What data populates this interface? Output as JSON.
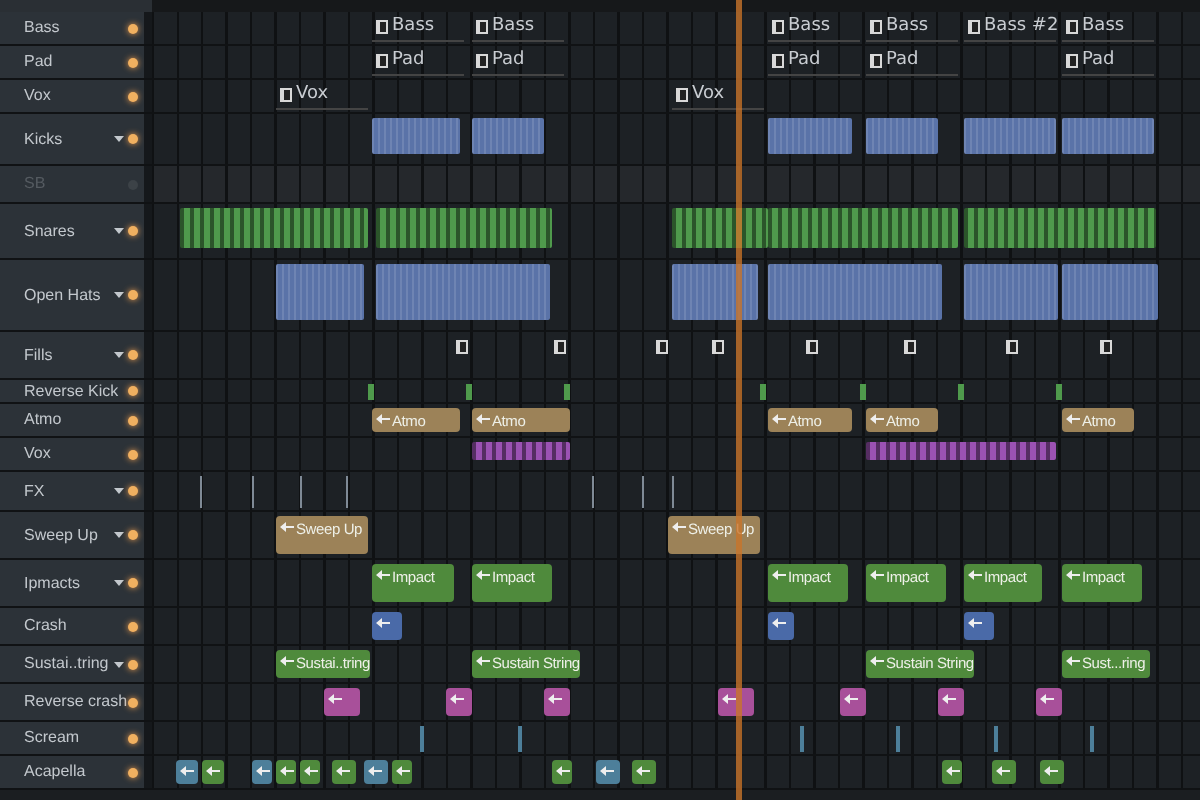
{
  "tracks": [
    {
      "name": "Bass",
      "dropdown": false,
      "muted": false,
      "clips": [
        {
          "kind": "pattern",
          "label": "Bass"
        },
        {
          "kind": "pattern",
          "label": "Bass"
        },
        {
          "kind": "pattern",
          "label": "Bass"
        },
        {
          "kind": "pattern",
          "label": "Bass"
        },
        {
          "kind": "pattern",
          "label": "Bass #2"
        },
        {
          "kind": "pattern",
          "label": "Bass"
        }
      ]
    },
    {
      "name": "Pad",
      "dropdown": false,
      "muted": false,
      "clips": [
        {
          "kind": "pattern",
          "label": "Pad"
        },
        {
          "kind": "pattern",
          "label": "Pad"
        },
        {
          "kind": "pattern",
          "label": "Pad"
        },
        {
          "kind": "pattern",
          "label": "Pad"
        },
        {
          "kind": "pattern",
          "label": "Pad"
        }
      ]
    },
    {
      "name": "Vox",
      "dropdown": false,
      "muted": false,
      "clips": [
        {
          "kind": "pattern",
          "label": "Vox"
        },
        {
          "kind": "pattern",
          "label": "Vox"
        }
      ]
    },
    {
      "name": "Kicks",
      "dropdown": true,
      "muted": false,
      "clips": [
        {
          "kind": "block",
          "color": "#5a73a8"
        },
        {
          "kind": "block",
          "color": "#5a73a8"
        },
        {
          "kind": "block",
          "color": "#5a73a8"
        },
        {
          "kind": "block",
          "color": "#5a73a8"
        },
        {
          "kind": "block",
          "color": "#5a73a8"
        },
        {
          "kind": "block",
          "color": "#5a73a8"
        }
      ]
    },
    {
      "name": "SB",
      "dropdown": false,
      "muted": true
    },
    {
      "name": "Snares",
      "dropdown": true,
      "muted": false,
      "clips": [
        {
          "kind": "stripes",
          "color": "#4f9a4c"
        },
        {
          "kind": "stripes",
          "color": "#4f9a4c"
        },
        {
          "kind": "stripes",
          "color": "#4f9a4c"
        },
        {
          "kind": "stripes",
          "color": "#4f9a4c"
        },
        {
          "kind": "stripes",
          "color": "#4f9a4c"
        }
      ]
    },
    {
      "name": "Open Hats",
      "dropdown": true,
      "muted": false,
      "clips": [
        {
          "kind": "block",
          "color": "#5a73a8"
        },
        {
          "kind": "block",
          "color": "#5a73a8"
        },
        {
          "kind": "block",
          "color": "#5a73a8"
        },
        {
          "kind": "block",
          "color": "#5a73a8"
        },
        {
          "kind": "block",
          "color": "#5a73a8"
        },
        {
          "kind": "block",
          "color": "#5a73a8"
        }
      ]
    },
    {
      "name": "Fills",
      "dropdown": true,
      "muted": false,
      "clips": [
        {
          "kind": "mini"
        },
        {
          "kind": "mini"
        },
        {
          "kind": "mini"
        },
        {
          "kind": "mini"
        },
        {
          "kind": "mini"
        },
        {
          "kind": "mini"
        },
        {
          "kind": "mini"
        },
        {
          "kind": "mini"
        }
      ]
    },
    {
      "name": "Reverse Kick",
      "dropdown": false,
      "muted": false,
      "clips": [
        {
          "kind": "mark",
          "color": "#4f9a4c"
        },
        {
          "kind": "mark",
          "color": "#4f9a4c"
        },
        {
          "kind": "mark",
          "color": "#4f9a4c"
        },
        {
          "kind": "mark",
          "color": "#4f9a4c"
        },
        {
          "kind": "mark",
          "color": "#4f9a4c"
        },
        {
          "kind": "mark",
          "color": "#4f9a4c"
        },
        {
          "kind": "mark",
          "color": "#4f9a4c"
        }
      ]
    },
    {
      "name": "Atmo",
      "dropdown": false,
      "muted": false,
      "clips": [
        {
          "kind": "audio",
          "label": "Atmo",
          "color": "#9c8258"
        },
        {
          "kind": "audio",
          "label": "Atmo",
          "color": "#9c8258"
        },
        {
          "kind": "audio",
          "label": "Atmo",
          "color": "#9c8258"
        },
        {
          "kind": "audio",
          "label": "Atmo",
          "color": "#9c8258"
        },
        {
          "kind": "audio",
          "label": "Atmo",
          "color": "#9c8258"
        }
      ]
    },
    {
      "name": "Vox",
      "dropdown": false,
      "muted": false,
      "clips": [
        {
          "kind": "stripes",
          "color": "#9b52b3"
        },
        {
          "kind": "stripes",
          "color": "#9b52b3"
        }
      ]
    },
    {
      "name": "FX",
      "dropdown": true,
      "muted": false,
      "clips": [
        {
          "kind": "mark",
          "color": "#7f8a96"
        },
        {
          "kind": "mark",
          "color": "#7f8a96"
        },
        {
          "kind": "mark",
          "color": "#7f8a96"
        },
        {
          "kind": "mark",
          "color": "#7f8a96"
        },
        {
          "kind": "mark",
          "color": "#7f8a96"
        },
        {
          "kind": "mark",
          "color": "#7f8a96"
        },
        {
          "kind": "mark",
          "color": "#7f8a96"
        }
      ]
    },
    {
      "name": "Sweep Up",
      "dropdown": true,
      "muted": false,
      "clips": [
        {
          "kind": "audio",
          "label": "Sweep Up",
          "color": "#9c8258"
        },
        {
          "kind": "audio",
          "label": "Sweep Up",
          "color": "#9c8258"
        }
      ]
    },
    {
      "name": "Ipmacts",
      "dropdown": true,
      "muted": false,
      "clips": [
        {
          "kind": "audio",
          "label": "Impact",
          "color": "#4f8a3c"
        },
        {
          "kind": "audio",
          "label": "Impact",
          "color": "#4f8a3c"
        },
        {
          "kind": "audio",
          "label": "Impact",
          "color": "#4f8a3c"
        },
        {
          "kind": "audio",
          "label": "Impact",
          "color": "#4f8a3c"
        },
        {
          "kind": "audio",
          "label": "Impact",
          "color": "#4f8a3c"
        },
        {
          "kind": "audio",
          "label": "Impact",
          "color": "#4f8a3c"
        }
      ]
    },
    {
      "name": "Crash",
      "dropdown": false,
      "muted": false,
      "clips": [
        {
          "kind": "audio",
          "color": "#4a6aa8"
        },
        {
          "kind": "audio",
          "color": "#4a6aa8"
        },
        {
          "kind": "audio",
          "color": "#4a6aa8"
        }
      ]
    },
    {
      "name": "Sustai..tring",
      "dropdown": true,
      "muted": false,
      "clips": [
        {
          "kind": "audio",
          "label": "Sustai..tring",
          "color": "#4f8a3c"
        },
        {
          "kind": "audio",
          "label": "Sustain String",
          "color": "#4f8a3c"
        },
        {
          "kind": "audio",
          "label": "Sustain String",
          "color": "#4f8a3c"
        },
        {
          "kind": "audio",
          "label": "Sust...ring",
          "color": "#4f8a3c"
        }
      ]
    },
    {
      "name": "Reverse crash",
      "dropdown": false,
      "muted": false,
      "clips": [
        {
          "kind": "audio",
          "color": "#a8509a"
        },
        {
          "kind": "audio",
          "color": "#a8509a"
        },
        {
          "kind": "audio",
          "color": "#a8509a"
        },
        {
          "kind": "audio",
          "color": "#a8509a"
        },
        {
          "kind": "audio",
          "color": "#a8509a"
        },
        {
          "kind": "audio",
          "color": "#a8509a"
        },
        {
          "kind": "audio",
          "color": "#a8509a"
        }
      ]
    },
    {
      "name": "Scream",
      "dropdown": false,
      "muted": false,
      "clips": [
        {
          "kind": "mark",
          "color": "#4d7f9a"
        },
        {
          "kind": "mark",
          "color": "#4d7f9a"
        },
        {
          "kind": "mark",
          "color": "#4d7f9a"
        },
        {
          "kind": "mark",
          "color": "#4d7f9a"
        },
        {
          "kind": "mark",
          "color": "#4d7f9a"
        },
        {
          "kind": "mark",
          "color": "#4d7f9a"
        }
      ]
    },
    {
      "name": "Acapella",
      "dropdown": false,
      "muted": false,
      "clips": [
        {
          "kind": "audio",
          "color": "#4d7f9a"
        },
        {
          "kind": "audio",
          "color": "#4f8a3c"
        },
        {
          "kind": "audio",
          "color": "#4d7f9a"
        },
        {
          "kind": "audio",
          "color": "#4f8a3c"
        },
        {
          "kind": "audio",
          "color": "#4f8a3c"
        },
        {
          "kind": "audio",
          "color": "#4f8a3c"
        },
        {
          "kind": "audio",
          "color": "#4d7f9a"
        },
        {
          "kind": "audio",
          "color": "#4f8a3c"
        },
        {
          "kind": "audio",
          "color": "#4f8a3c"
        },
        {
          "kind": "audio",
          "color": "#4d7f9a"
        },
        {
          "kind": "audio",
          "color": "#4f8a3c"
        },
        {
          "kind": "audio",
          "color": "#4f8a3c"
        },
        {
          "kind": "audio",
          "color": "#4f8a3c"
        },
        {
          "kind": "audio",
          "color": "#4f8a3c"
        }
      ]
    }
  ]
}
